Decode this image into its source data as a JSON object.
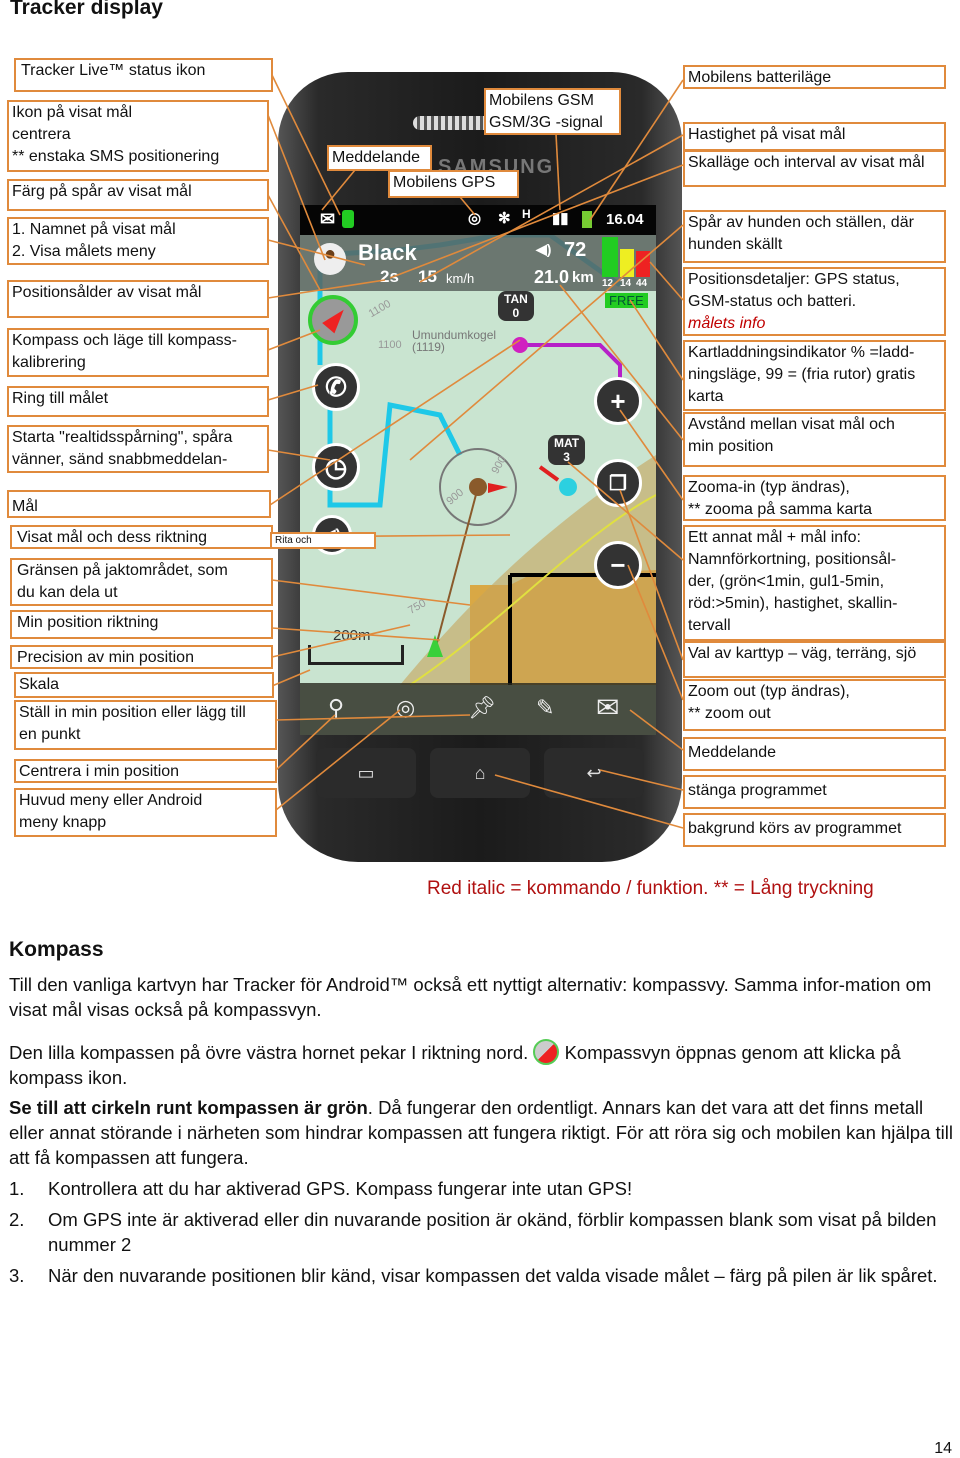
{
  "title": "Tracker display",
  "colors": {
    "label_border": "#e08a3c",
    "command_red": "#c00000"
  },
  "left_labels": [
    "Tracker Live™ status ikon",
    "Ikon på visat mål\ncentrera\n** enstaka SMS positionering",
    "Färg på spår av visat mål",
    "1. Namnet på visat mål\n2. Visa målets meny",
    "Positionsålder av visat mål",
    "Kompass och läge till kompass-\nkalibrering",
    "Ring till målet",
    "Starta \"realtidsspårning\", spåra\nvänner, sänd snabbmeddelan-",
    "Mål",
    "Visat mål och dess riktning",
    "Gränsen på jaktområdet, som\ndu kan dela ut",
    "Min position riktning",
    "Precision av min position",
    "Skala",
    "Ställ in min position eller lägg till\nen punkt",
    "Centrera i min position",
    "Huvud meny eller Android\nmeny knapp"
  ],
  "top_labels": {
    "gsm": "Mobilens GSM\nGSM/3G -signal",
    "message": "Meddelande",
    "gps": "Mobilens GPS",
    "draw": "Rita och"
  },
  "right_labels": [
    "Mobilens batteriläge",
    "Hastighet på visat mål",
    "Skalläge och interval av visat mål",
    "Spår av hunden och ställen, där\nhunden skällt",
    "Positionsdetaljer: GPS status,\nGSM-status och batteri.",
    "Kartladdningsindikator % =ladd-\nningsläge, 99 = (fria rutor) gratis\nkarta",
    "Avstånd mellan visat mål och\nmin position",
    "Zooma-in (typ ändras),\n** zooma på samma karta",
    "Ett annat mål + mål info:\nNamnförkortning, positionsål-\nder, (grön<1min, gul1-5min,\nröd:>5min), hastighet, skallin-\ntervall",
    "Val av karttyp – väg, terräng, sjö",
    "Zoom out (typ ändras),\n ** zoom out",
    "Meddelande",
    "stänga programmet",
    "bakgrund körs av programmet"
  ],
  "target_info_command": "målets info",
  "phone": {
    "brand": "SAMSUNG",
    "clock": "16.04",
    "target_name": "Black",
    "position_age": "2s",
    "speed": "15",
    "speed_unit": "km/h",
    "bark_interval": "72",
    "distance": "21.0",
    "distance_unit": "km",
    "bar_values": [
      "12",
      "14",
      "44"
    ],
    "map_status": "FREE",
    "other_target": {
      "name": "TAN",
      "age": "0"
    },
    "other_target2": {
      "name": "MAT",
      "age": "3"
    },
    "peak": "Umundumkogel\n(1119)",
    "contours": [
      "1100",
      "1100",
      "900",
      "900",
      "750"
    ],
    "scale": "200m"
  },
  "legend": "Red italic = kommando / funktion. ** = Lång tryckning",
  "section": {
    "heading": "Kompass",
    "p1": "Till den vanliga kartvyn har Tracker för Android™ också ett nyttigt alternativ: kompassvy. Samma infor-mation om visat mål visas också på kompassvyn.",
    "p2a": "Den lilla kompassen på övre västra hornet pekar I riktning nord.",
    "p2b": "Kompassvyn öppnas genom att klicka på kompass ikon.",
    "p3_bold": "Se till att cirkeln runt kompassen är grön",
    "p3": ". Då fungerar den ordentligt.  Annars kan det vara att det finns metall eller annat störande i närheten som hindrar kompassen att fungera riktigt. För att röra sig och mobilen kan hjälpa till att få kompassen att fungera.",
    "list": [
      {
        "n": "1.",
        "text": "Kontrollera att du har aktiverad GPS. Kompass fungerar inte utan GPS!"
      },
      {
        "n": "2.",
        "text": "Om GPS inte är aktiverad eller din nuvarande position är okänd, förblir kompassen blank som visat på bilden nummer 2"
      },
      {
        "n": "3.",
        "text": "När den nuvarande positionen blir känd, visar kompassen det valda visade målet – färg på pilen är lik spåret."
      }
    ]
  },
  "page_number": "14"
}
